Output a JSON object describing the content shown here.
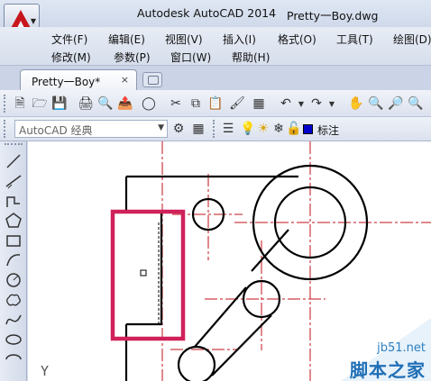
{
  "window": {
    "app_title": "Autodesk AutoCAD 2014",
    "doc_title": "Pretty一Boy.dwg"
  },
  "menu": {
    "row1": [
      "文件(F)",
      "编辑(E)",
      "视图(V)",
      "插入(I)",
      "格式(O)",
      "工具(T)",
      "绘图(D)"
    ],
    "row2": [
      "修改(M)",
      "参数(P)",
      "窗口(W)",
      "帮助(H)"
    ]
  },
  "tabs": {
    "active": "Pretty一Boy*",
    "close_symbol": "×"
  },
  "toolbar": {
    "workspace_value": "AutoCAD 经典",
    "layer_name": "标注",
    "layer_color": "#0000cc"
  },
  "canvas": {
    "ucs_label": "Y",
    "highlight_color": "#d0215a",
    "centerline_color": "#c0121a"
  },
  "watermark": {
    "url": "jb51.net",
    "text": "脚本之家"
  },
  "colors": {
    "brand_red": "#c8161d",
    "accent_blue": "#1f6fb6"
  }
}
